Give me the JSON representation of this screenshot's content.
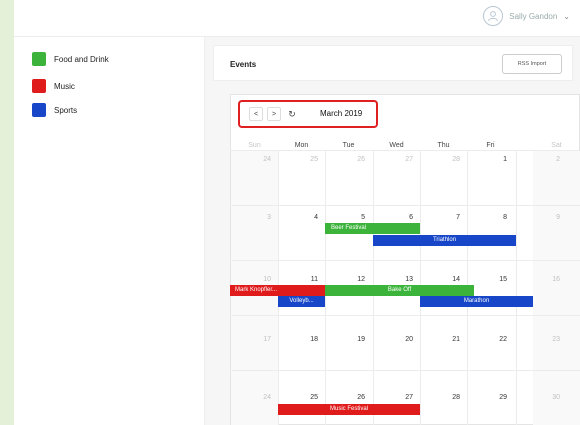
{
  "user": {
    "name": "Sally Gandon",
    "avatar_icon": "user-avatar-icon",
    "chevron_icon": "chevron-down-icon"
  },
  "sidebar": {
    "categories": [
      {
        "label": "Food and Drink",
        "color": "#3cb43c"
      },
      {
        "label": "Music",
        "color": "#e01b1b"
      },
      {
        "label": "Sports",
        "color": "#1747c8"
      }
    ]
  },
  "events_panel": {
    "title": "Events",
    "rss_button": "RSS Import"
  },
  "calendar": {
    "nav": {
      "prev": "<",
      "next": ">",
      "refresh_icon": "refresh-icon",
      "refresh": "↻",
      "month": "March 2019"
    },
    "weekdays": [
      "Sun",
      "Mon",
      "Tue",
      "Wed",
      "Thu",
      "Fri",
      "Sat"
    ],
    "weeks": [
      [
        "24",
        "25",
        "26",
        "27",
        "28",
        "1",
        "2"
      ],
      [
        "3",
        "4",
        "5",
        "6",
        "7",
        "8",
        "9"
      ],
      [
        "10",
        "11",
        "12",
        "13",
        "14",
        "15",
        "16"
      ],
      [
        "17",
        "18",
        "19",
        "20",
        "21",
        "22",
        "23"
      ],
      [
        "24",
        "25",
        "26",
        "27",
        "28",
        "29",
        "30"
      ]
    ],
    "events": [
      {
        "name": "Beer Festival",
        "category": "Food and Drink"
      },
      {
        "name": "Triathlon",
        "category": "Sports"
      },
      {
        "name": "Mark Knopfler...",
        "category": "Music"
      },
      {
        "name": "Bake Off",
        "category": "Food and Drink"
      },
      {
        "name": "Volleyb...",
        "category": "Sports"
      },
      {
        "name": "Marathon",
        "category": "Sports"
      },
      {
        "name": "Music Festival",
        "category": "Music"
      }
    ]
  }
}
